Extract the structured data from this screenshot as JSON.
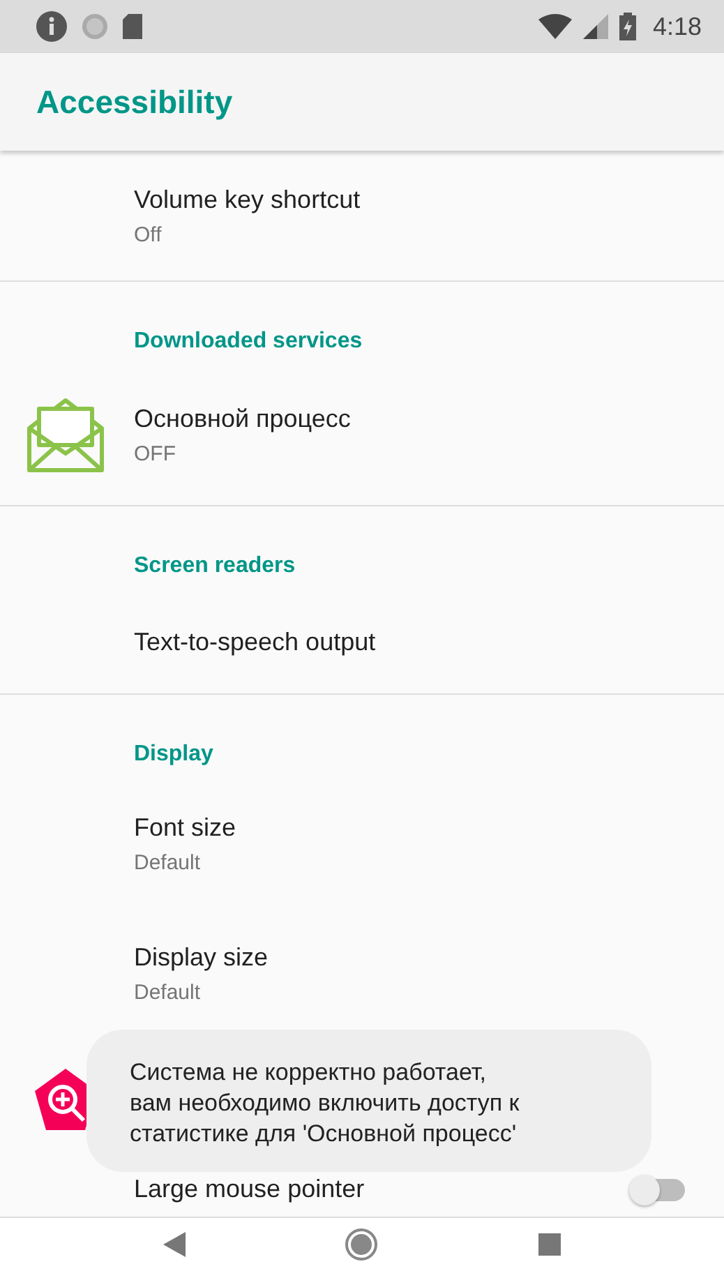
{
  "status_bar": {
    "time": "4:18"
  },
  "app_bar": {
    "title": "Accessibility"
  },
  "sections": [
    {
      "items": [
        {
          "kind": "text",
          "title": "Volume key shortcut",
          "summary": "Off"
        }
      ]
    },
    {
      "header": "Downloaded services",
      "items": [
        {
          "kind": "app",
          "title": "Основной процесс",
          "summary": "OFF"
        }
      ]
    },
    {
      "header": "Screen readers",
      "items": [
        {
          "kind": "text",
          "title": "Text-to-speech output"
        }
      ]
    },
    {
      "header": "Display",
      "items": [
        {
          "kind": "text",
          "title": "Font size",
          "summary": "Default"
        },
        {
          "kind": "text",
          "title": "Display size",
          "summary": "Default"
        },
        {
          "kind": "feature"
        },
        {
          "kind": "switch",
          "title": "Large mouse pointer",
          "on": false
        }
      ]
    }
  ],
  "toast": {
    "text": "Система не корректно работает,\nвам необходимо включить доступ к\nстатистике для 'Основной процесс'"
  }
}
